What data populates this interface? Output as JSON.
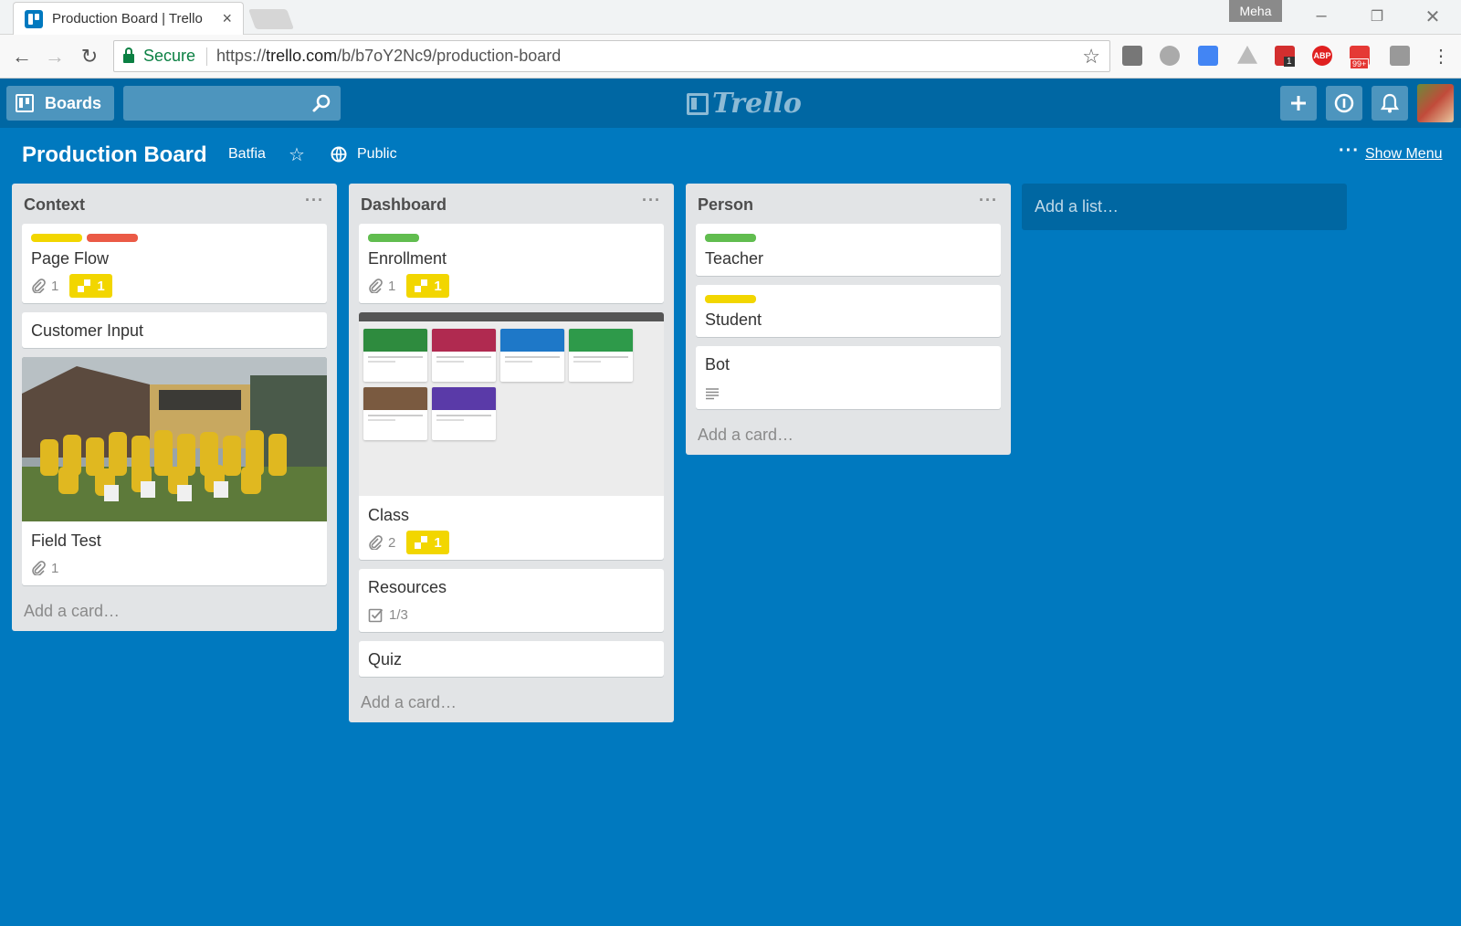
{
  "browser": {
    "tab_title": "Production Board | Trello",
    "profile_name": "Meha",
    "secure_label": "Secure",
    "url_scheme": "https://",
    "url_host": "trello.com",
    "url_path": "/b/b7oY2Nc9/production-board",
    "ext_badges": {
      "mail": "1",
      "notify": "99+",
      "abp": "ABP"
    }
  },
  "header": {
    "boards_label": "Boards",
    "logo_text": "Trello",
    "search_placeholder": ""
  },
  "board": {
    "title": "Production Board",
    "team": "Batfia",
    "visibility": "Public",
    "show_menu": "Show Menu",
    "menu_dots": "···"
  },
  "lists": [
    {
      "title": "Context",
      "add_card": "Add a card…",
      "cards": [
        {
          "title": "Page Flow",
          "labels": [
            "#f2d600",
            "#eb5a46"
          ],
          "attachments": "1",
          "badge": "1"
        },
        {
          "title": "Customer Input"
        },
        {
          "title": "Field Test",
          "cover": "photo",
          "attachments": "1"
        }
      ]
    },
    {
      "title": "Dashboard",
      "add_card": "Add a card…",
      "cards": [
        {
          "title": "Enrollment",
          "labels": [
            "#61bd4f"
          ],
          "attachments": "1",
          "badge": "1"
        },
        {
          "title": "Class",
          "cover": "screenshot",
          "attachments": "2",
          "badge": "1"
        },
        {
          "title": "Resources",
          "checklist": "1/3"
        },
        {
          "title": "Quiz"
        }
      ]
    },
    {
      "title": "Person",
      "add_card": "Add a card…",
      "cards": [
        {
          "title": "Teacher",
          "labels": [
            "#61bd4f"
          ]
        },
        {
          "title": "Student",
          "labels": [
            "#f2d600"
          ]
        },
        {
          "title": "Bot",
          "description": true
        }
      ]
    }
  ],
  "add_list": "Add a list…",
  "colors": {
    "board_bg": "#0079bf",
    "header_bg": "#0067a3",
    "list_bg": "#e2e4e6",
    "label_yellow": "#f2d600",
    "label_red": "#eb5a46",
    "label_green": "#61bd4f"
  }
}
